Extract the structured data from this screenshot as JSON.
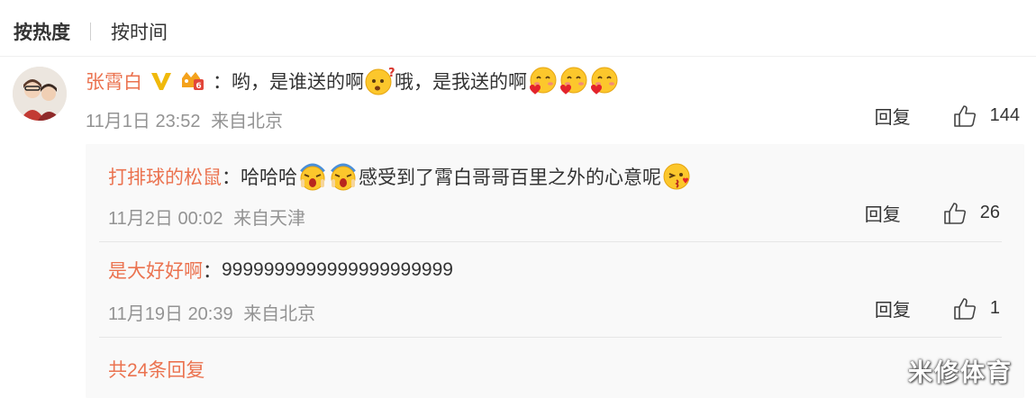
{
  "sort": {
    "hot": "按热度",
    "time": "按时间"
  },
  "comment": {
    "username": "张霄白",
    "colon": "：",
    "text_part1": "哟，是谁送的啊",
    "text_part2": "哦，是我送的啊",
    "datetime": "11月1日 23:52",
    "location": "来自北京",
    "reply_label": "回复",
    "likes": "144"
  },
  "replies": [
    {
      "username": "打排球的松鼠",
      "colon": "：",
      "text_part1": "哈哈哈",
      "text_part2": "感受到了霄白哥哥百里之外的心意呢",
      "datetime": "11月2日 00:02",
      "location": "来自天津",
      "reply_label": "回复",
      "likes": "26"
    },
    {
      "username": "是大好好啊",
      "colon": "：",
      "text_part1": "9999999999999999999999",
      "datetime": "11月19日 20:39",
      "location": "来自北京",
      "reply_label": "回复",
      "likes": "1"
    }
  ],
  "more_replies": "共24条回复",
  "watermark": "米修体育",
  "colors": {
    "accent": "#eb7350",
    "meta": "#939393",
    "text": "#333333",
    "subbox": "#f9f9f9"
  },
  "icons": [
    "verified-v-icon",
    "fan-badge-icon",
    "thumbs-up-icon",
    "blush-emoji",
    "question-emoji",
    "hearts-emoji",
    "scream-emoji",
    "kiss-emoji"
  ]
}
